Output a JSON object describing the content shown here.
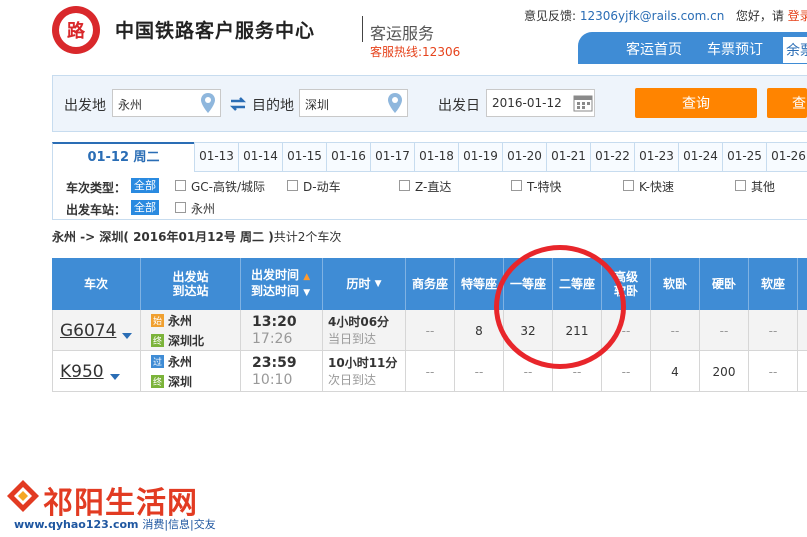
{
  "header": {
    "site_name": "中国铁路客户服务中心",
    "section": "客运服务",
    "hotline": "客服热线:12306",
    "feedback_label": "意见反馈:",
    "feedback_email": "12306yjfk@rails.com.cn",
    "greeting": "您好，请",
    "login": "登录",
    "nav": [
      "客运首页",
      "车票预订",
      "余票"
    ]
  },
  "search": {
    "from_label": "出发地",
    "from_value": "永州",
    "to_label": "目的地",
    "to_value": "深圳",
    "date_label": "出发日",
    "date_value": "2016-01-12",
    "query_button": "查询",
    "query_button_2": "查"
  },
  "dates": {
    "active": "01-12 周二",
    "tabs": [
      "01-13",
      "01-14",
      "01-15",
      "01-16",
      "01-17",
      "01-18",
      "01-19",
      "01-20",
      "01-21",
      "01-22",
      "01-23",
      "01-24",
      "01-25",
      "01-26"
    ]
  },
  "filters": {
    "type_label": "车次类型：",
    "station_label": "出发车站：",
    "all": "全部",
    "types": [
      "GC-高铁/城际",
      "D-动车",
      "Z-直达",
      "T-特快",
      "K-快速",
      "其他"
    ],
    "stations": [
      "永州"
    ]
  },
  "summary": {
    "route": "永州 -> 深圳",
    "date": "( 2016年01月12号  周二 )",
    "count": "共计2个车次"
  },
  "table": {
    "headers": {
      "train": "车次",
      "station_1": "出发站",
      "station_2": "到达站",
      "time_1": "出发时间",
      "time_2": "到达时间",
      "duration": "历时",
      "business": "商务座",
      "special": "特等座",
      "first": "一等座",
      "second": "二等座",
      "premium_1": "高级",
      "premium_2": "软卧",
      "soft_sleeper": "软卧",
      "hard_sleeper": "硬卧",
      "soft_seat": "软座"
    },
    "rows": [
      {
        "train": "G6074",
        "from_tag": "始",
        "from": "永州",
        "to_tag": "终",
        "to": "深圳北",
        "depart": "13:20",
        "arrive": "17:26",
        "duration": "4小时06分",
        "arrive_day": "当日到达",
        "business": "--",
        "special": "8",
        "first": "32",
        "second": "211",
        "premium": "--",
        "soft_sleeper": "--",
        "hard_sleeper": "--",
        "soft_seat": "--"
      },
      {
        "train": "K950",
        "from_tag": "过",
        "from": "永州",
        "to_tag": "终",
        "to": "深圳",
        "depart": "23:59",
        "arrive": "10:10",
        "duration": "10小时11分",
        "arrive_day": "次日到达",
        "business": "--",
        "special": "--",
        "first": "--",
        "second": "--",
        "premium": "--",
        "soft_sleeper": "4",
        "hard_sleeper": "200",
        "soft_seat": "--"
      }
    ]
  },
  "watermark": {
    "brand": "祁阳生活网",
    "url": "www.qyhao123.com",
    "tags": "消费|信息|交友"
  },
  "colors": {
    "brand_red": "#d9282b",
    "nav_blue": "#3f8cd5",
    "button_orange": "#ff8400",
    "highlight_red": "#e8262b"
  }
}
